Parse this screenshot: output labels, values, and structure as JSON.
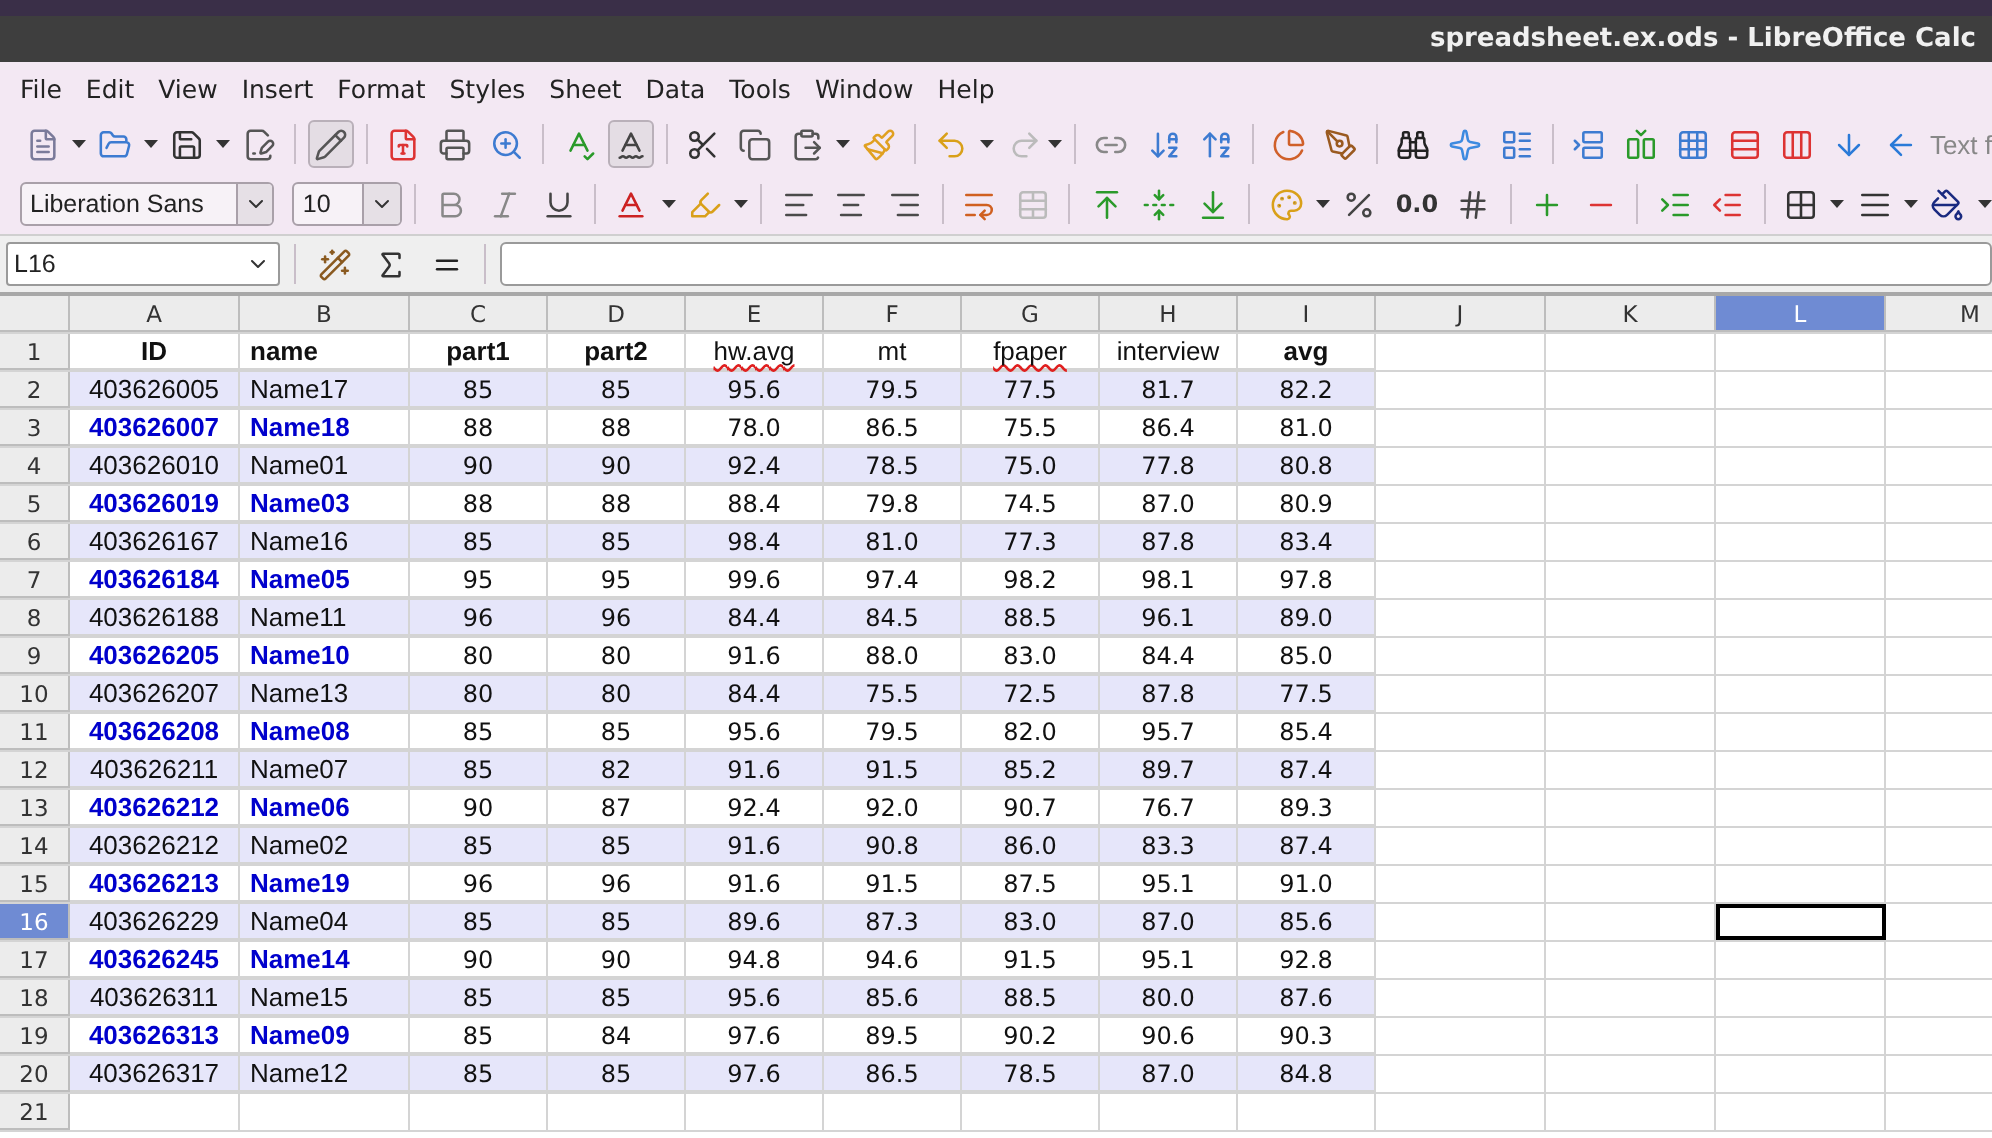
{
  "window": {
    "title": "spreadsheet.ex.ods - LibreOffice Calc"
  },
  "menu": [
    "File",
    "Edit",
    "View",
    "Insert",
    "Format",
    "Styles",
    "Sheet",
    "Data",
    "Tools",
    "Window",
    "Help"
  ],
  "standard_toolbar": {
    "edit_mode_pressed": true,
    "auto_spellcheck_pressed": true,
    "redo_disabled": true,
    "trailing_label": "Text f"
  },
  "formatting_toolbar": {
    "font_name": "Liberation Sans",
    "font_size": "10",
    "number_format_label": "0.0",
    "merge_disabled": true
  },
  "formula_bar": {
    "name_box": "L16"
  },
  "columns": [
    {
      "label": "A",
      "selected": false
    },
    {
      "label": "B",
      "selected": false
    },
    {
      "label": "C",
      "selected": false
    },
    {
      "label": "D",
      "selected": false
    },
    {
      "label": "E",
      "selected": false
    },
    {
      "label": "F",
      "selected": false
    },
    {
      "label": "G",
      "selected": false
    },
    {
      "label": "H",
      "selected": false
    },
    {
      "label": "I",
      "selected": false
    },
    {
      "label": "J",
      "selected": false
    },
    {
      "label": "K",
      "selected": false
    },
    {
      "label": "L",
      "selected": true
    },
    {
      "label": "M",
      "selected": false
    }
  ],
  "rows": [
    {
      "number": "1",
      "selected": false,
      "kind": "header",
      "cells": [
        {
          "text": "ID",
          "bold": true,
          "misspelled": false
        },
        {
          "text": "name",
          "bold": true,
          "misspelled": false
        },
        {
          "text": "part1",
          "bold": true,
          "misspelled": false
        },
        {
          "text": "part2",
          "bold": true,
          "misspelled": false
        },
        {
          "text": "hw.avg",
          "bold": false,
          "misspelled": true
        },
        {
          "text": "mt",
          "bold": false,
          "misspelled": false
        },
        {
          "text": "fpaper",
          "bold": false,
          "misspelled": true
        },
        {
          "text": "interview",
          "bold": false,
          "misspelled": false
        },
        {
          "text": "avg",
          "bold": true,
          "misspelled": false
        }
      ]
    },
    {
      "number": "2",
      "selected": false,
      "kind": "banded",
      "cells": [
        "403626005",
        "Name17",
        "85",
        "85",
        "95.6",
        "79.5",
        "77.5",
        "81.7",
        "82.2"
      ]
    },
    {
      "number": "3",
      "selected": false,
      "kind": "emphasis",
      "cells": [
        "403626007",
        "Name18",
        "88",
        "88",
        "78.0",
        "86.5",
        "75.5",
        "86.4",
        "81.0"
      ]
    },
    {
      "number": "4",
      "selected": false,
      "kind": "banded",
      "cells": [
        "403626010",
        "Name01",
        "90",
        "90",
        "92.4",
        "78.5",
        "75.0",
        "77.8",
        "80.8"
      ]
    },
    {
      "number": "5",
      "selected": false,
      "kind": "emphasis",
      "cells": [
        "403626019",
        "Name03",
        "88",
        "88",
        "88.4",
        "79.8",
        "74.5",
        "87.0",
        "80.9"
      ]
    },
    {
      "number": "6",
      "selected": false,
      "kind": "banded",
      "cells": [
        "403626167",
        "Name16",
        "85",
        "85",
        "98.4",
        "81.0",
        "77.3",
        "87.8",
        "83.4"
      ]
    },
    {
      "number": "7",
      "selected": false,
      "kind": "emphasis",
      "cells": [
        "403626184",
        "Name05",
        "95",
        "95",
        "99.6",
        "97.4",
        "98.2",
        "98.1",
        "97.8"
      ]
    },
    {
      "number": "8",
      "selected": false,
      "kind": "banded",
      "cells": [
        "403626188",
        "Name11",
        "96",
        "96",
        "84.4",
        "84.5",
        "88.5",
        "96.1",
        "89.0"
      ]
    },
    {
      "number": "9",
      "selected": false,
      "kind": "emphasis",
      "cells": [
        "403626205",
        "Name10",
        "80",
        "80",
        "91.6",
        "88.0",
        "83.0",
        "84.4",
        "85.0"
      ]
    },
    {
      "number": "10",
      "selected": false,
      "kind": "banded",
      "cells": [
        "403626207",
        "Name13",
        "80",
        "80",
        "84.4",
        "75.5",
        "72.5",
        "87.8",
        "77.5"
      ]
    },
    {
      "number": "11",
      "selected": false,
      "kind": "emphasis",
      "cells": [
        "403626208",
        "Name08",
        "85",
        "85",
        "95.6",
        "79.5",
        "82.0",
        "95.7",
        "85.4"
      ]
    },
    {
      "number": "12",
      "selected": false,
      "kind": "banded",
      "cells": [
        "403626211",
        "Name07",
        "85",
        "82",
        "91.6",
        "91.5",
        "85.2",
        "89.7",
        "87.4"
      ]
    },
    {
      "number": "13",
      "selected": false,
      "kind": "emphasis",
      "cells": [
        "403626212",
        "Name06",
        "90",
        "87",
        "92.4",
        "92.0",
        "90.7",
        "76.7",
        "89.3"
      ]
    },
    {
      "number": "14",
      "selected": false,
      "kind": "banded",
      "cells": [
        "403626212",
        "Name02",
        "85",
        "85",
        "91.6",
        "90.8",
        "86.0",
        "83.3",
        "87.4"
      ]
    },
    {
      "number": "15",
      "selected": false,
      "kind": "emphasis",
      "cells": [
        "403626213",
        "Name19",
        "96",
        "96",
        "91.6",
        "91.5",
        "87.5",
        "95.1",
        "91.0"
      ]
    },
    {
      "number": "16",
      "selected": true,
      "kind": "banded",
      "cells": [
        "403626229",
        "Name04",
        "85",
        "85",
        "89.6",
        "87.3",
        "83.0",
        "87.0",
        "85.6"
      ]
    },
    {
      "number": "17",
      "selected": false,
      "kind": "emphasis",
      "cells": [
        "403626245",
        "Name14",
        "90",
        "90",
        "94.8",
        "94.6",
        "91.5",
        "95.1",
        "92.8"
      ]
    },
    {
      "number": "18",
      "selected": false,
      "kind": "banded",
      "cells": [
        "403626311",
        "Name15",
        "85",
        "85",
        "95.6",
        "85.6",
        "88.5",
        "80.0",
        "87.6"
      ]
    },
    {
      "number": "19",
      "selected": false,
      "kind": "emphasis",
      "cells": [
        "403626313",
        "Name09",
        "85",
        "84",
        "97.6",
        "89.5",
        "90.2",
        "90.6",
        "90.3"
      ]
    },
    {
      "number": "20",
      "selected": false,
      "kind": "banded",
      "cells": [
        "403626317",
        "Name12",
        "85",
        "85",
        "97.6",
        "86.5",
        "78.5",
        "87.0",
        "84.8"
      ]
    },
    {
      "number": "21",
      "selected": false,
      "kind": "empty"
    }
  ]
}
